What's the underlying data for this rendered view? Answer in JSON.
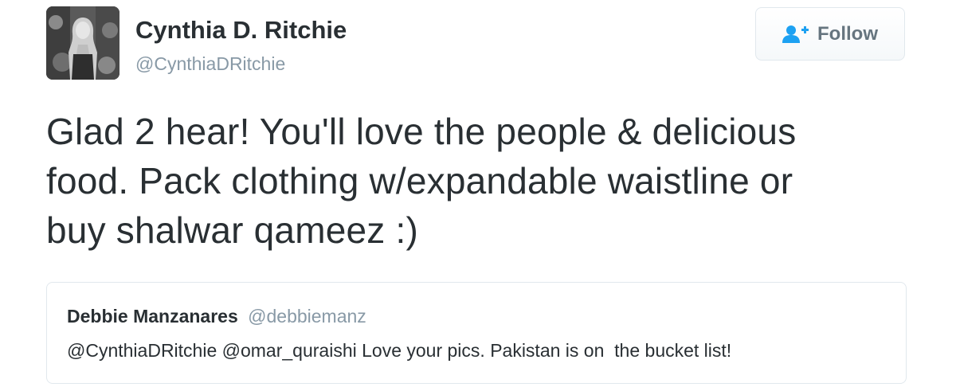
{
  "author": {
    "display_name": "Cynthia D. Ritchie",
    "screen_name": "@CynthiaDRitchie",
    "avatar_icon": "profile-photo"
  },
  "follow_button": {
    "label": "Follow",
    "icon": "add-user-icon",
    "icon_color": "#1da1f2"
  },
  "tweet": {
    "lines": [
      "Glad 2 hear! You'll love the people & delicious",
      "food. Pack clothing w/expandable waistline or",
      "buy shalwar qameez :)"
    ]
  },
  "quoted_tweet": {
    "display_name": "Debbie Manzanares",
    "screen_name": "@debbiemanz",
    "text": "@CynthiaDRitchie @omar_quraishi Love your pics. Pakistan is on  the bucket list!"
  },
  "colors": {
    "text_primary": "#292f33",
    "text_secondary": "#8899a6",
    "border": "#e1e8ed",
    "accent": "#1da1f2"
  }
}
